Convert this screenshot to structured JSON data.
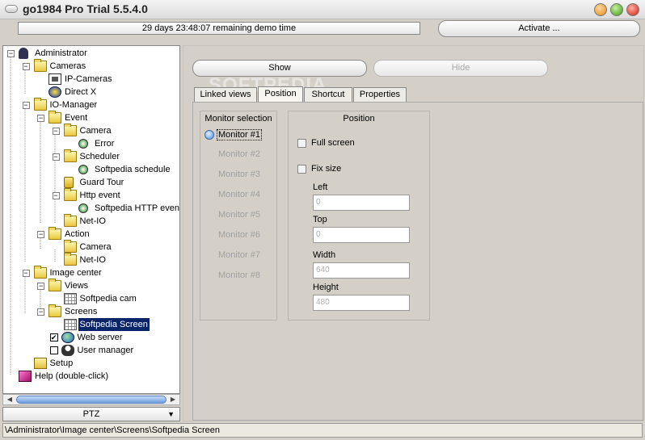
{
  "window": {
    "title": "go1984 Pro Trial 5.5.4.0"
  },
  "demo": {
    "remaining": "29 days 23:48:07 remaining demo time",
    "activate_label": "Activate ..."
  },
  "tree": {
    "items": [
      {
        "label": "Administrator",
        "icon": "person-icon"
      },
      {
        "label": "Cameras",
        "icon": "folder-icon"
      },
      {
        "label": "IP-Cameras",
        "icon": "camera-icon"
      },
      {
        "label": "Direct X",
        "icon": "directx-icon"
      },
      {
        "label": "IO-Manager",
        "icon": "folder-icon"
      },
      {
        "label": "Event",
        "icon": "folder-icon"
      },
      {
        "label": "Camera",
        "icon": "folder-icon"
      },
      {
        "label": "Error",
        "icon": "event-icon"
      },
      {
        "label": "Scheduler",
        "icon": "folder-icon"
      },
      {
        "label": "Softpedia schedule",
        "icon": "event-icon"
      },
      {
        "label": "Guard Tour",
        "icon": "lock-icon"
      },
      {
        "label": "Http event",
        "icon": "folder-icon"
      },
      {
        "label": "Softpedia HTTP event",
        "icon": "event-icon"
      },
      {
        "label": "Net-IO",
        "icon": "folder-icon"
      },
      {
        "label": "Action",
        "icon": "folder-icon"
      },
      {
        "label": "Camera",
        "icon": "folder-icon"
      },
      {
        "label": "Net-IO",
        "icon": "folder-icon"
      },
      {
        "label": "Image center",
        "icon": "folder-icon"
      },
      {
        "label": "Views",
        "icon": "folder-icon"
      },
      {
        "label": "Softpedia cam",
        "icon": "grid-icon"
      },
      {
        "label": "Screens",
        "icon": "folder-icon"
      },
      {
        "label": "Softpedia Screen",
        "icon": "grid-icon"
      },
      {
        "label": "Web server",
        "icon": "globe-icon"
      },
      {
        "label": "User manager",
        "icon": "users-icon"
      },
      {
        "label": "Setup",
        "icon": "setup-icon"
      },
      {
        "label": "Help (double-click)",
        "icon": "book-icon"
      }
    ],
    "selected": "Softpedia Screen"
  },
  "ptz": {
    "label": "PTZ"
  },
  "status": {
    "path": "\\Administrator\\Image center\\Screens\\Softpedia Screen"
  },
  "toolbar": {
    "show_label": "Show",
    "hide_label": "Hide"
  },
  "tabs": [
    {
      "label": "Linked views"
    },
    {
      "label": "Position"
    },
    {
      "label": "Shortcut"
    },
    {
      "label": "Properties"
    }
  ],
  "active_tab": "Position",
  "watermark": "SOFTPEDIA",
  "monitor_selection": {
    "title": "Monitor selection",
    "items": [
      "Monitor #1",
      "Monitor #2",
      "Monitor #3",
      "Monitor #4",
      "Monitor #5",
      "Monitor #6",
      "Monitor #7",
      "Monitor #8"
    ],
    "selected": "Monitor #1"
  },
  "position": {
    "title": "Position",
    "full_screen_label": "Full screen",
    "full_screen_checked": false,
    "fix_size_label": "Fix size",
    "fix_size_checked": false,
    "left_label": "Left",
    "left_value": "0",
    "top_label": "Top",
    "top_value": "0",
    "width_label": "Width",
    "width_value": "640",
    "height_label": "Height",
    "height_value": "480"
  }
}
